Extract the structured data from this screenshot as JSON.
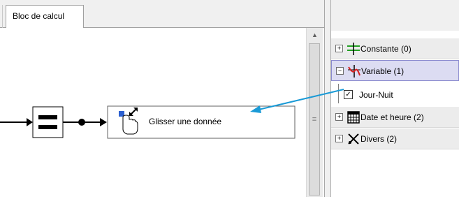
{
  "tab": {
    "label": "Bloc de calcul"
  },
  "flow": {
    "drop_block_label": "Glisser une donnée"
  },
  "panel": {
    "groups": [
      {
        "expander": "+",
        "label": "Constante (0)",
        "icon": "constant-icon"
      },
      {
        "expander": "−",
        "label": "Variable (1)",
        "icon": "variable-icon",
        "selected": true
      },
      {
        "expander": "+",
        "label": "Date et heure (2)",
        "icon": "calendar-icon"
      },
      {
        "expander": "+",
        "label": "Divers (2)",
        "icon": "misc-icon"
      }
    ],
    "child": {
      "label": "Jour-Nuit",
      "checked": true
    }
  },
  "colors": {
    "selected_group_bg": "#dcdcf2",
    "arrow_blue": "#1a9ad6",
    "constant_green": "#22a022",
    "variable_red": "#d62020"
  }
}
